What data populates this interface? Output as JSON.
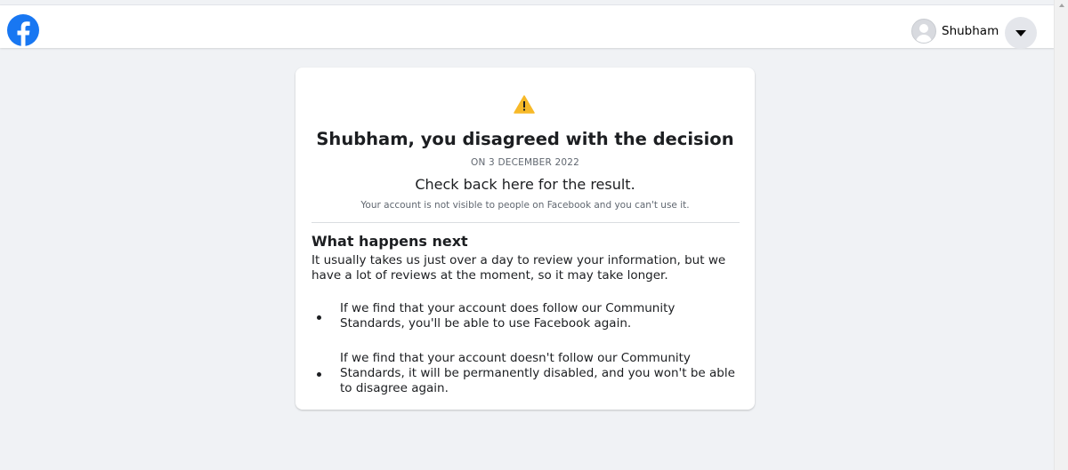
{
  "header": {
    "user_name": "Shubham",
    "icons": {
      "logo": "facebook-logo",
      "avatar": "default-avatar-icon",
      "menu": "caret-down-icon"
    },
    "brand_color": "#1877f2"
  },
  "card": {
    "icon": "warning-icon",
    "title": "Shubham, you disagreed with the decision",
    "date": "ON 3 DECEMBER 2022",
    "check_back": "Check back here for the result.",
    "note": "Your account is not visible to people on Facebook and you can't use it.",
    "next_heading": "What happens next",
    "next_text": "It usually takes us just over a day to review your information, but we have a lot of reviews at the moment, so it may take longer.",
    "bullets": [
      "If we find that your account does follow our Community Standards, you'll be able to use Facebook again.",
      "If we find that your account doesn't follow our Community Standards, it will be permanently disabled, and you won't be able to disagree again."
    ]
  }
}
